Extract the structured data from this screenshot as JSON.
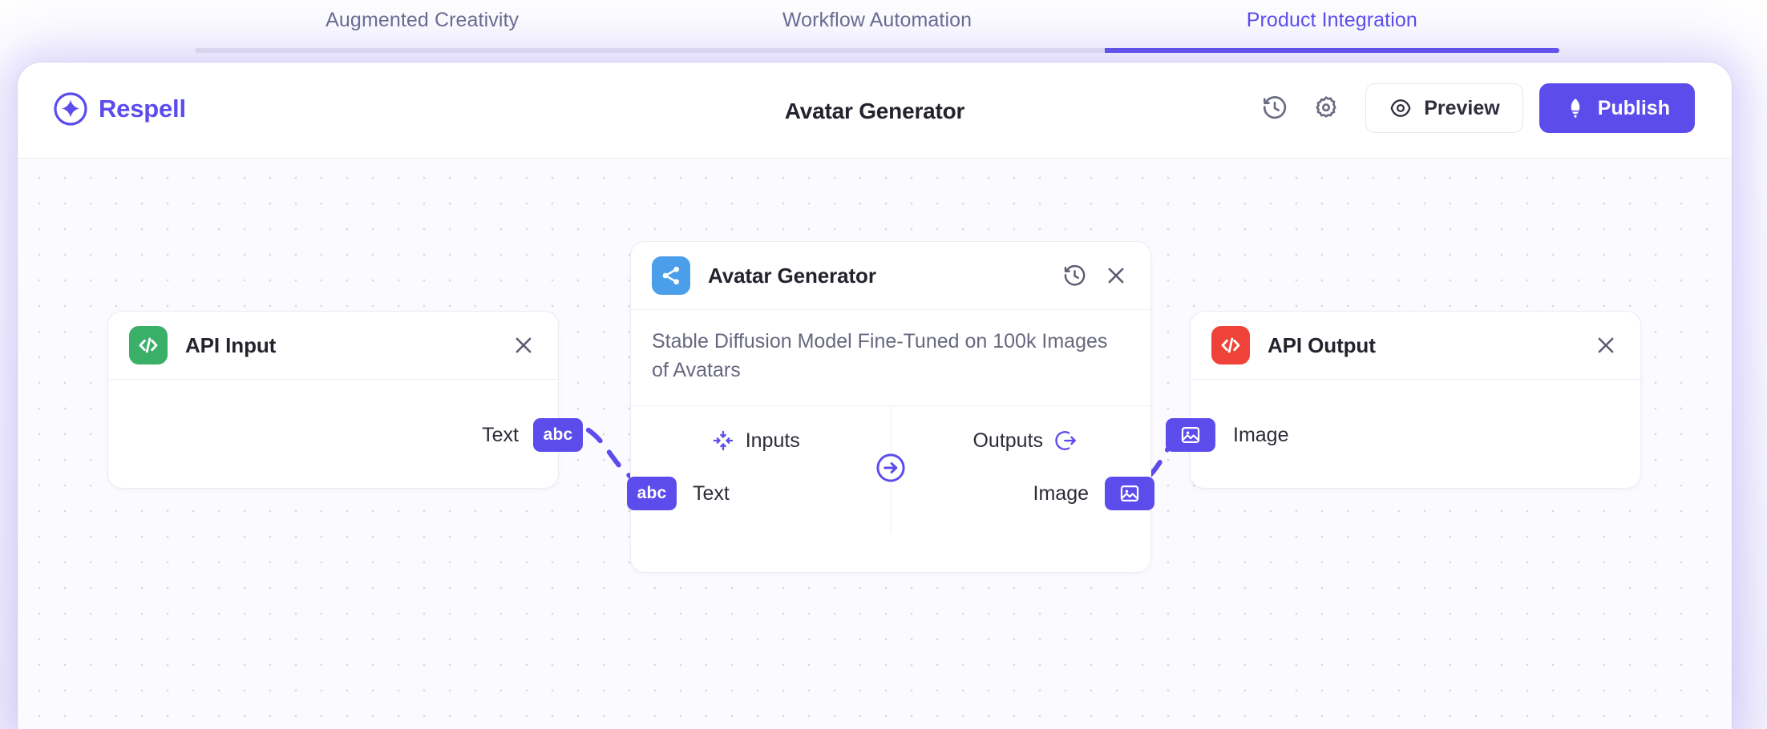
{
  "tabs": [
    {
      "label": "Augmented Creativity",
      "active": false
    },
    {
      "label": "Workflow Automation",
      "active": false
    },
    {
      "label": "Product Integration",
      "active": true
    }
  ],
  "colors": {
    "accent": "#5b4ceb",
    "tab_inactive_text": "#6b6c8e",
    "tab_track": "#ebeaf2",
    "node_green": "#3aaf68",
    "node_red": "#ef4238",
    "node_blue": "#4a9eea",
    "canvas_bg": "#fafaff",
    "text_primary": "#23232e",
    "text_muted": "#67687f"
  },
  "app": {
    "brand": {
      "name": "Respell",
      "icon": "sparkle-circle-icon"
    },
    "title": "Avatar Generator",
    "actions": {
      "history_icon": "history-clock-icon",
      "settings_icon": "gear-icon",
      "preview_label": "Preview",
      "preview_icon": "eye-target-icon",
      "publish_label": "Publish",
      "publish_icon": "rocket-icon"
    }
  },
  "canvas": {
    "nodes": [
      {
        "id": "api-input",
        "title": "API Input",
        "icon": "code-brackets-icon",
        "icon_color": "#3aaf68",
        "close_icon": "close-icon",
        "ports": [
          {
            "label": "Text",
            "type_icon": "abc",
            "side": "right"
          }
        ]
      },
      {
        "id": "avatar-generator",
        "title": "Avatar Generator",
        "icon": "share-nodes-icon",
        "icon_color": "#4a9eea",
        "history_icon": "history-clock-icon",
        "close_icon": "close-icon",
        "description": "Stable Diffusion Model Fine-Tuned on 100k Images of Avatars",
        "inputs_label": "Inputs",
        "inputs_icon": "collapse-arrows-icon",
        "outputs_label": "Outputs",
        "outputs_icon": "circle-arrow-out-icon",
        "toggle_icon": "circle-arrow-right-icon",
        "inputs": [
          {
            "label": "Text",
            "type_icon": "abc"
          }
        ],
        "outputs": [
          {
            "label": "Image",
            "type_icon": "image"
          }
        ]
      },
      {
        "id": "api-output",
        "title": "API Output",
        "icon": "code-brackets-icon",
        "icon_color": "#ef4238",
        "close_icon": "close-icon",
        "ports": [
          {
            "label": "Image",
            "type_icon": "image",
            "side": "left"
          }
        ]
      }
    ],
    "connections": [
      {
        "from": "api-input.Text",
        "to": "avatar-generator.Text"
      },
      {
        "from": "avatar-generator.Image",
        "to": "api-output.Image"
      }
    ]
  }
}
